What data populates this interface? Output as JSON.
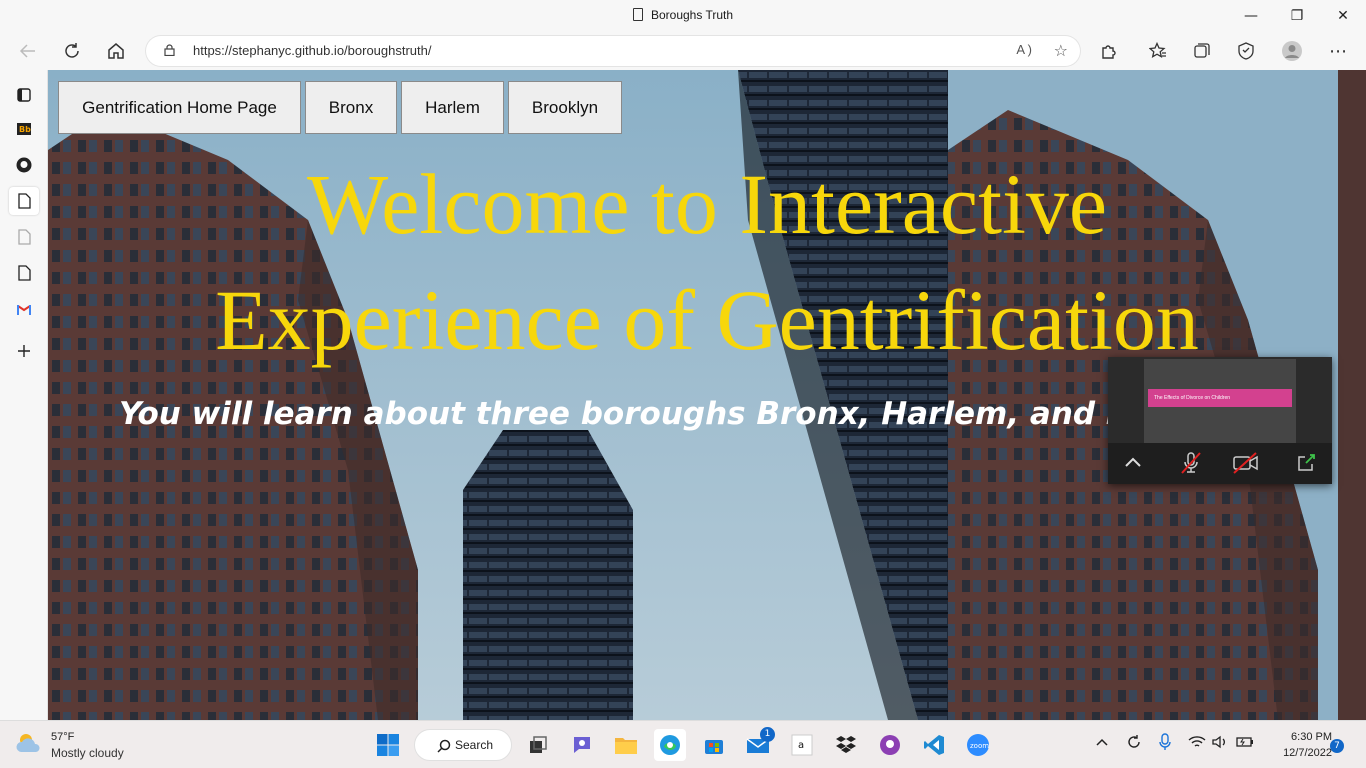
{
  "window": {
    "title": "Boroughs Truth",
    "minimize": "—",
    "maximize": "❐",
    "close": "✕"
  },
  "toolbar": {
    "url": "https://stephanyc.github.io/boroughstruth/",
    "read_aloud": "A )"
  },
  "page": {
    "nav": [
      "Gentrification Home Page",
      "Bronx",
      "Harlem",
      "Brooklyn"
    ],
    "headline_1": "Welcome to Interactive",
    "headline_2": "Experience of Gentrification",
    "subline": "You will learn about three boroughs Bronx, Harlem, and Brooklyn",
    "headline_color": "#f7d70b"
  },
  "widget": {
    "slide_title": "The Effects of Divorce on Children"
  },
  "taskbar": {
    "temp": "57°F",
    "weather": "Mostly cloudy",
    "search": "Search",
    "time": "6:30 PM",
    "date": "12/7/2022",
    "mail_badge": "1",
    "notifications": "7"
  }
}
